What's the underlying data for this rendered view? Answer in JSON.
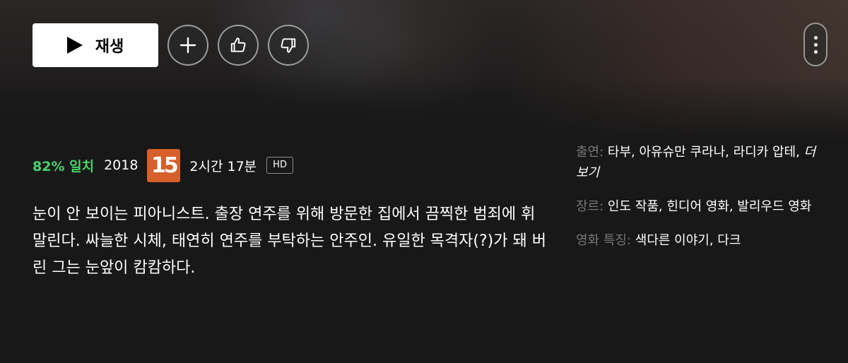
{
  "controls": {
    "play_label": "재생",
    "add_icon": "plus-icon",
    "like_icon": "thumbs-up-icon",
    "dislike_icon": "thumbs-down-icon",
    "more_icon": "more-vertical-icon"
  },
  "meta": {
    "match": "82% 일치",
    "year": "2018",
    "rating": "15",
    "duration": "2시간 17분",
    "quality": "HD"
  },
  "synopsis": "눈이 안 보이는 피아니스트. 출장 연주를 위해 방문한 집에서 끔찍한 범죄에 휘말린다. 싸늘한 시체, 태연히 연주를 부탁하는 안주인. 유일한 목격자(?)가 돼 버린 그는 눈앞이 캄캄하다.",
  "details": {
    "cast_label": "출연:",
    "cast_value": "타부, 아유슈만 쿠라나, 라디카 압테,",
    "cast_more": "더 보기",
    "genre_label": "장르:",
    "genre_value": "인도 작품, 힌디어 영화, 발리우드 영화",
    "features_label": "영화 특징:",
    "features_value": "색다른 이야기, 다크"
  },
  "colors": {
    "match_green": "#46d369",
    "rating_orange": "#d65f2a",
    "background": "#181818"
  }
}
